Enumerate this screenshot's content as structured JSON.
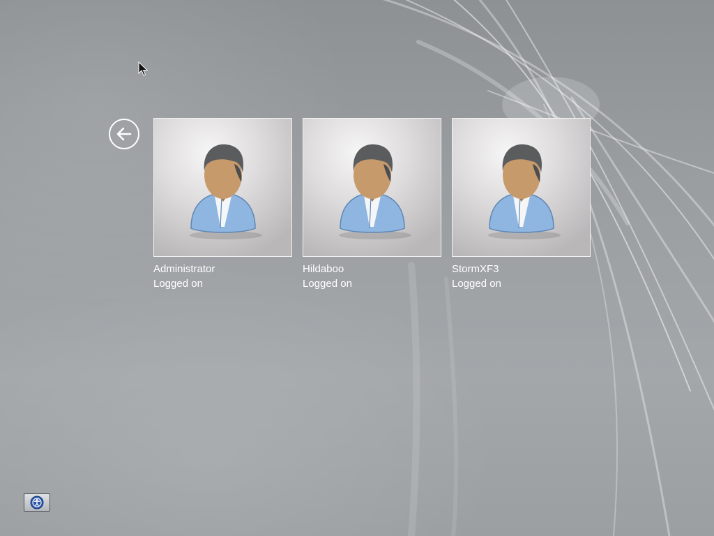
{
  "users": [
    {
      "name": "Administrator",
      "status": "Logged on",
      "icon": "user-avatar-icon"
    },
    {
      "name": "Hildaboo",
      "status": "Logged on",
      "icon": "user-avatar-icon"
    },
    {
      "name": "StormXF3",
      "status": "Logged on",
      "icon": "user-avatar-icon"
    }
  ],
  "controls": {
    "back_icon": "back-arrow-icon",
    "ease_of_access_icon": "ease-of-access-icon"
  },
  "colors": {
    "background": "#9a9ea1",
    "text": "#ffffff",
    "shirt": "#8fb6e0",
    "skin": "#c79a6c",
    "hair": "#5a5c5e"
  }
}
